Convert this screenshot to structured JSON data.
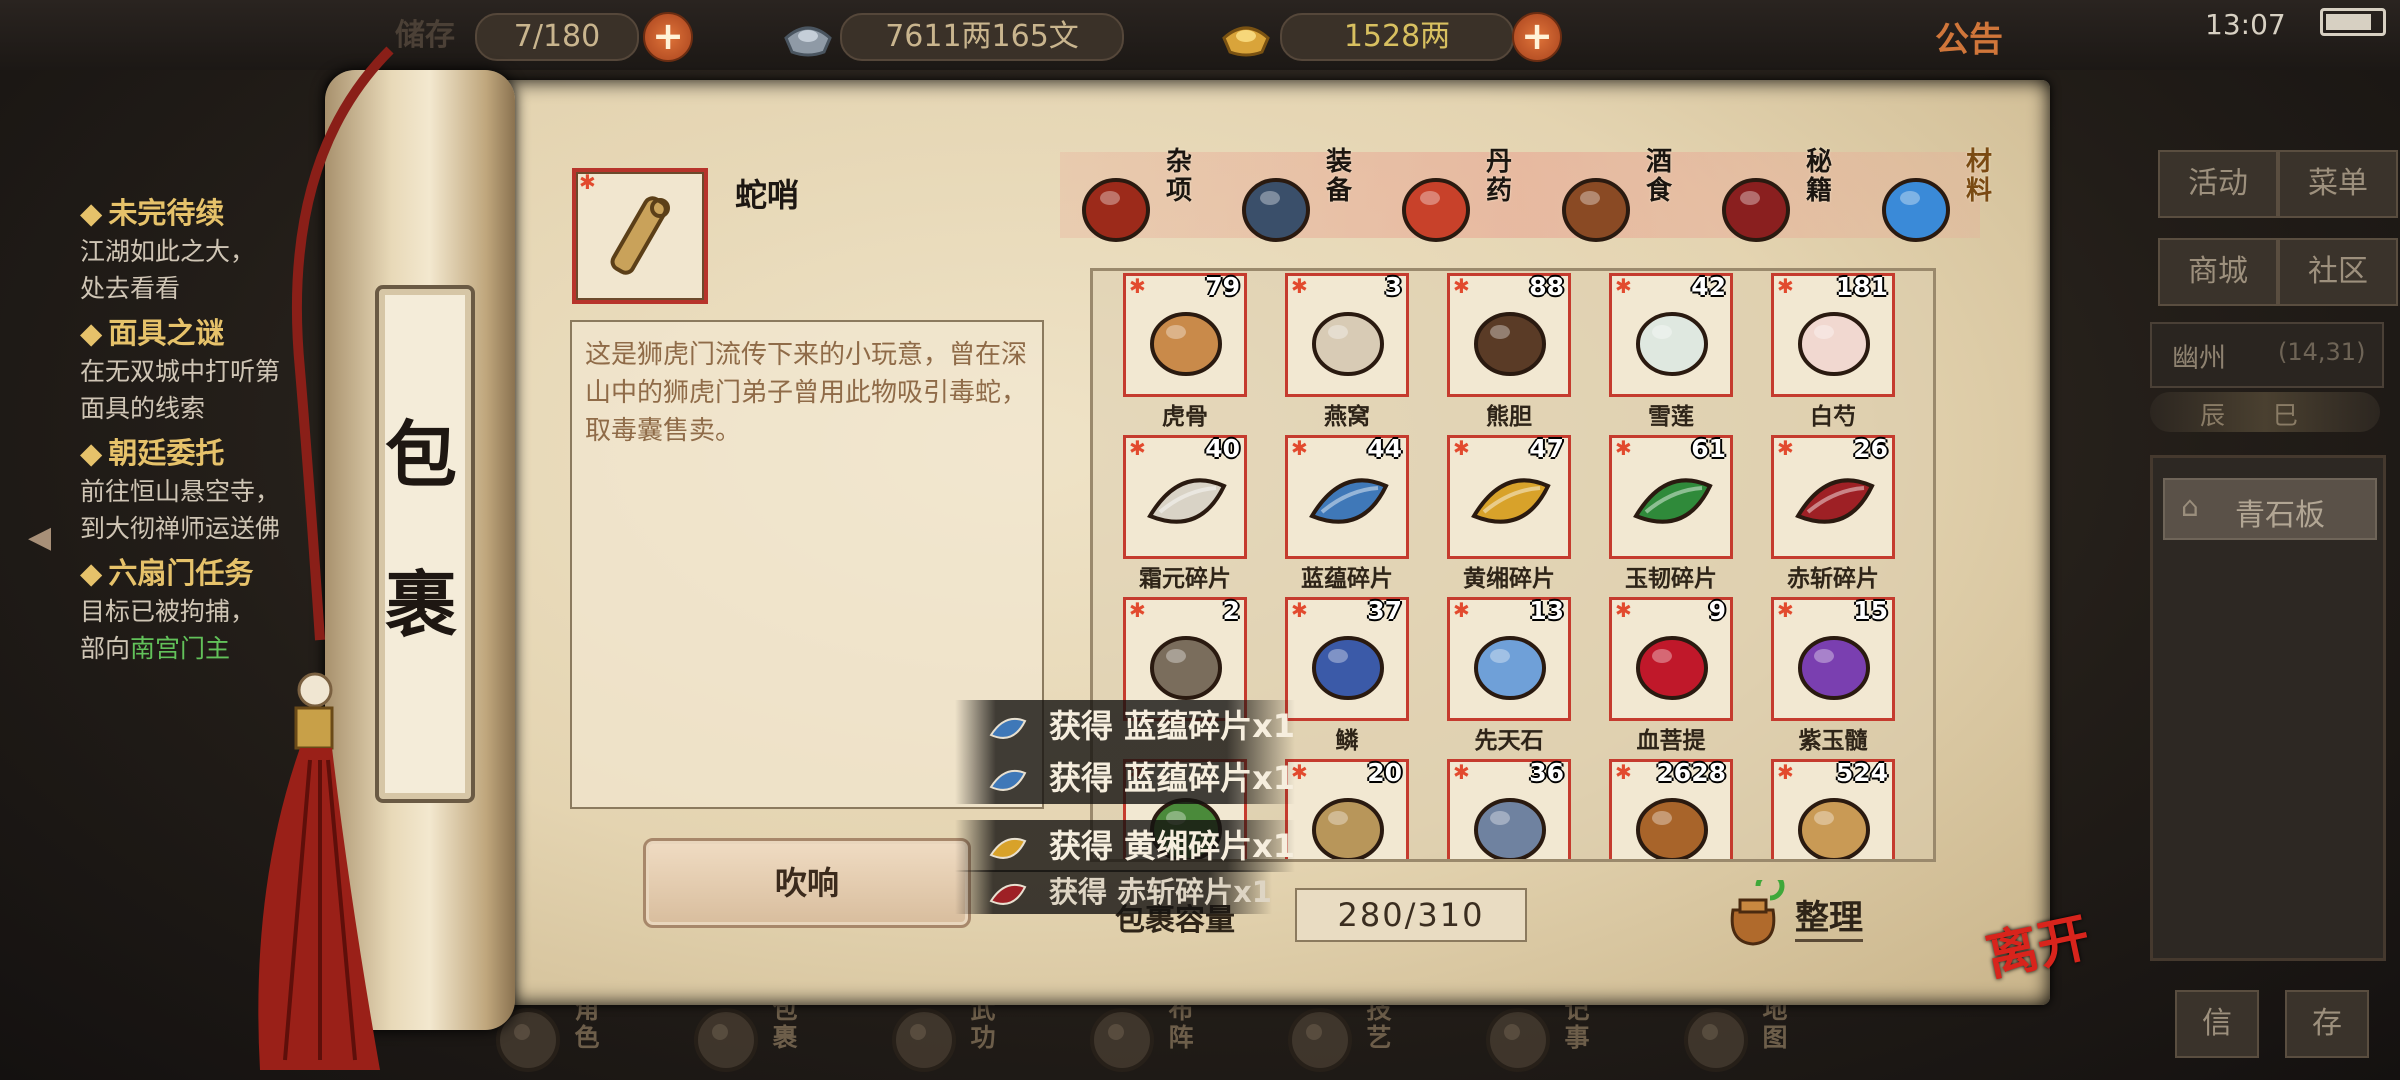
{
  "status_bar": {
    "time": "13:07"
  },
  "top_bar": {
    "bag_label": "储存",
    "bag_capacity": "7/180",
    "silver_value": "7611两165文",
    "gold_value": "1528两",
    "announcement_label": "公告",
    "icons": [
      "plus-icon",
      "silver-ingot-icon",
      "gold-ingot-icon",
      "plus-icon"
    ]
  },
  "quests": [
    {
      "title": "未完待续",
      "lines": [
        {
          "segments": [
            {
              "text": "江湖如此之大，",
              "hl": false
            }
          ]
        },
        {
          "segments": [
            {
              "text": "处去看看",
              "hl": false
            }
          ]
        }
      ]
    },
    {
      "title": "面具之谜",
      "lines": [
        {
          "segments": [
            {
              "text": "在无双城中打听第",
              "hl": false
            }
          ]
        },
        {
          "segments": [
            {
              "text": "面具的线索",
              "hl": false
            }
          ]
        }
      ]
    },
    {
      "title": "朝廷委托",
      "lines": [
        {
          "segments": [
            {
              "text": "前往恒山悬空寺，",
              "hl": false
            }
          ]
        },
        {
          "segments": [
            {
              "text": "到大彻禅师运送佛",
              "hl": false
            }
          ]
        }
      ]
    },
    {
      "title": "六扇门任务",
      "lines": [
        {
          "segments": [
            {
              "text": "目标已被拘捕，",
              "hl": false
            }
          ]
        },
        {
          "segments": [
            {
              "text": "部向",
              "hl": false
            },
            {
              "text": "南宫门主",
              "hl": true
            }
          ]
        }
      ]
    }
  ],
  "right_panel": {
    "buttons": [
      "活动",
      "菜单",
      "商城",
      "社区"
    ],
    "location_name": "幽州",
    "location_coords": "(14,31)",
    "time_of_day": "辰 巳",
    "map_item": "青石板",
    "bottom_buttons": [
      "信",
      "存"
    ]
  },
  "scroll": {
    "title_chars": [
      "包",
      "裹"
    ]
  },
  "selected_item": {
    "name": "蛇哨",
    "description": "这是狮虎门流传下来的小玩意，曾在深山中的狮虎门弟子曾用此物吸引毒蛇，取毒囊售卖。",
    "use_button": "吹响"
  },
  "tabs": [
    {
      "label": "杂项",
      "icon": "jar-icon",
      "active": false
    },
    {
      "label": "装备",
      "icon": "equipment-icon",
      "active": false
    },
    {
      "label": "丹药",
      "icon": "pill-icon",
      "active": false
    },
    {
      "label": "酒食",
      "icon": "food-icon",
      "active": false
    },
    {
      "label": "秘籍",
      "icon": "book-icon",
      "active": false
    },
    {
      "label": "材料",
      "icon": "crystal-icon",
      "active": true
    }
  ],
  "items": [
    {
      "name": "虎骨",
      "count": "79",
      "color": "#c98a4a",
      "icon": "bone-icon"
    },
    {
      "name": "燕窝",
      "count": "3",
      "color": "#d8cbb5",
      "icon": "nest-icon"
    },
    {
      "name": "熊胆",
      "count": "88",
      "color": "#5a3b26",
      "icon": "gallbladder-icon"
    },
    {
      "name": "雪莲",
      "count": "42",
      "color": "#dfe8e0",
      "icon": "lotus-icon"
    },
    {
      "name": "白芍",
      "count": "181",
      "color": "#f1d8d0",
      "icon": "peony-icon"
    },
    {
      "name": "霜元碎片",
      "count": "40",
      "color": "#d9d3c6",
      "icon": "shard-icon"
    },
    {
      "name": "蓝蕴碎片",
      "count": "44",
      "color": "#3f78b8",
      "icon": "shard-icon"
    },
    {
      "name": "黄缃碎片",
      "count": "47",
      "color": "#d8a22a",
      "icon": "shard-icon"
    },
    {
      "name": "玉韧碎片",
      "count": "61",
      "color": "#2f8a3a",
      "icon": "shard-icon"
    },
    {
      "name": "赤斩碎片",
      "count": "26",
      "color": "#9e2025",
      "icon": "shard-icon"
    },
    {
      "name": "",
      "count": "2",
      "color": "#7a6d5c",
      "icon": "buddha-statue-icon"
    },
    {
      "name": "鳞",
      "count": "37",
      "color": "#3b5aa8",
      "icon": "scale-icon"
    },
    {
      "name": "先天石",
      "count": "13",
      "color": "#6fa0d8",
      "icon": "rainbow-stone-icon"
    },
    {
      "name": "血菩提",
      "count": "9",
      "color": "#c0182a",
      "icon": "berry-icon"
    },
    {
      "name": "紫玉髓",
      "count": "15",
      "color": "#7a3fb0",
      "icon": "amethyst-icon"
    },
    {
      "name": "",
      "count": "",
      "color": "#4a8a3a",
      "icon": "herb-icon"
    },
    {
      "name": "",
      "count": "20",
      "color": "#b8965a",
      "icon": "dragon-icon"
    },
    {
      "name": "",
      "count": "36",
      "color": "#6f82a0",
      "icon": "ore-icon"
    },
    {
      "name": "",
      "count": "2628",
      "color": "#a8642a",
      "icon": "leather-icon"
    },
    {
      "name": "",
      "count": "524",
      "color": "#c99a55",
      "icon": "hide-icon"
    }
  ],
  "capacity": {
    "label": "包裹容量",
    "value": "280/310"
  },
  "sort_label": "整理",
  "leave_label": "离开",
  "bottom_nav": [
    {
      "label": "角色",
      "icon": "character-icon"
    },
    {
      "label": "包裹",
      "icon": "bag-icon"
    },
    {
      "label": "武功",
      "icon": "martial-arts-icon"
    },
    {
      "label": "布阵",
      "icon": "formation-icon"
    },
    {
      "label": "技艺",
      "icon": "skill-icon"
    },
    {
      "label": "记事",
      "icon": "journal-icon"
    },
    {
      "label": "地图",
      "icon": "map-icon"
    }
  ],
  "toasts": [
    {
      "text": "获得 蓝蕴碎片x1",
      "color": "#3f78b8"
    },
    {
      "text": "获得 蓝蕴碎片x1",
      "color": "#3f78b8"
    },
    {
      "text": "获得 黄缃碎片x1",
      "color": "#d8a22a"
    },
    {
      "text": "获得 赤斩碎片x1",
      "color": "#9e2025"
    }
  ]
}
